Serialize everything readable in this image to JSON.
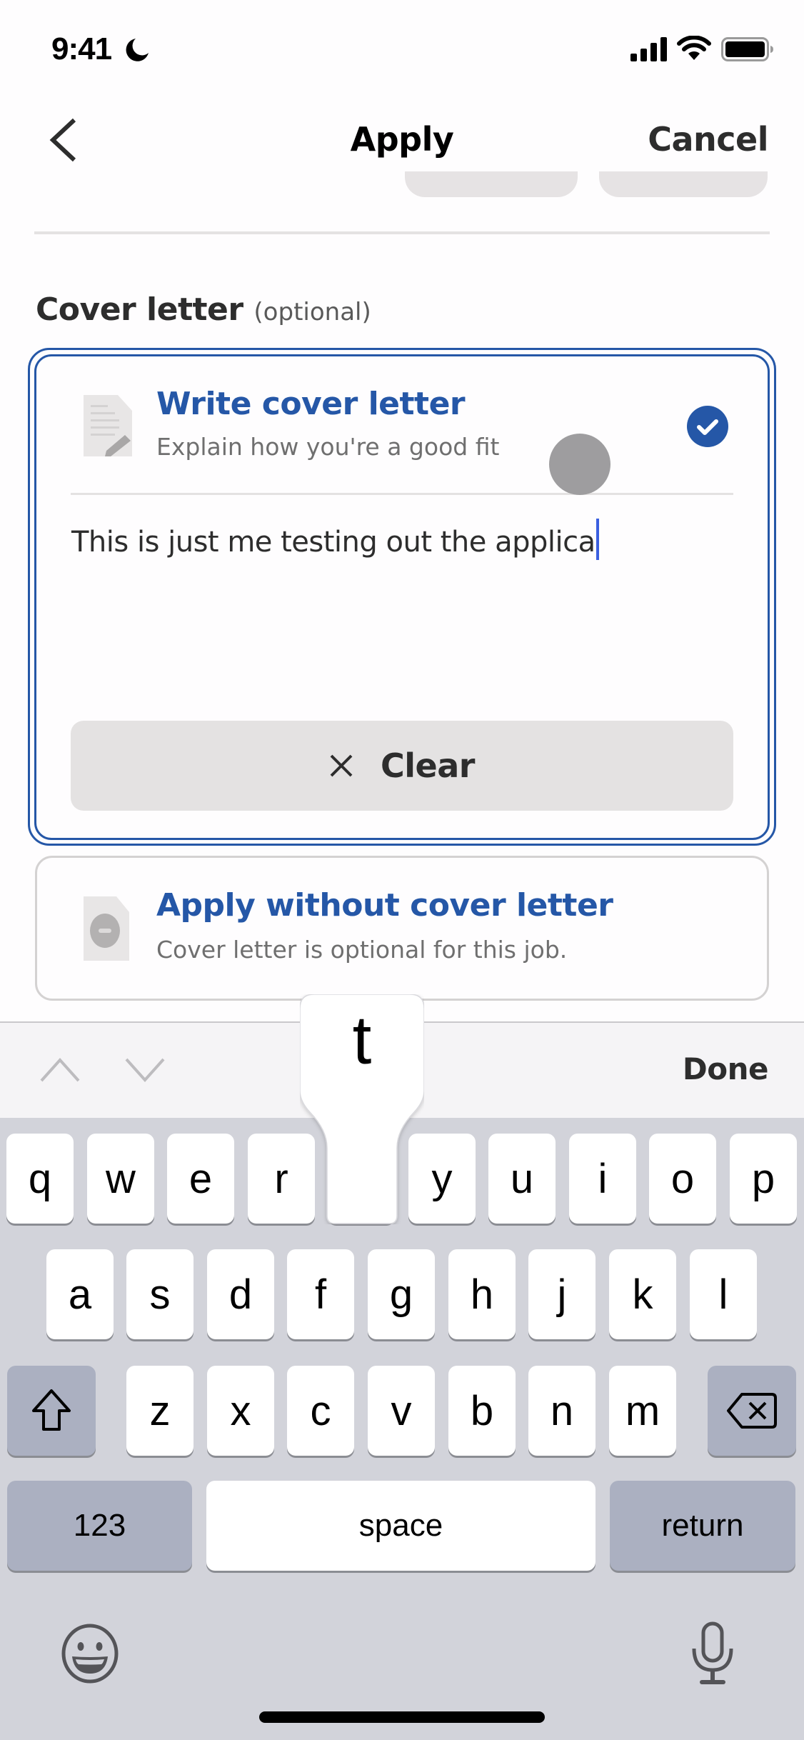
{
  "status_bar": {
    "time": "9:41",
    "focus_icon": "moon-icon",
    "icons": [
      "cellular-signal-icon",
      "wifi-icon",
      "battery-icon"
    ]
  },
  "nav": {
    "back_icon": "chevron-left-icon",
    "title": "Apply",
    "cancel_label": "Cancel"
  },
  "cover_letter": {
    "heading": "Cover letter",
    "heading_suffix": "(optional)",
    "options": [
      {
        "icon": "document-pencil-icon",
        "title": "Write cover letter",
        "subtitle": "Explain how you're a good fit",
        "selected": true,
        "text_value": "This is just me testing out the applica"
      },
      {
        "icon": "document-minus-icon",
        "title": "Apply without cover letter",
        "subtitle": "Cover letter is optional for this job.",
        "selected": false
      }
    ],
    "clear_label": "Clear",
    "clear_icon": "close-icon"
  },
  "keyboard_toolbar": {
    "prev_icon": "chevron-up-icon",
    "next_icon": "chevron-down-icon",
    "done_label": "Done"
  },
  "keyboard": {
    "row1": [
      "q",
      "w",
      "e",
      "r",
      "t",
      "y",
      "u",
      "i",
      "o",
      "p"
    ],
    "row2": [
      "a",
      "s",
      "d",
      "f",
      "g",
      "h",
      "j",
      "k",
      "l"
    ],
    "row3": [
      "z",
      "x",
      "c",
      "v",
      "b",
      "n",
      "m"
    ],
    "shift_icon": "shift-icon",
    "backspace_icon": "backspace-icon",
    "numbers_label": "123",
    "space_label": "space",
    "return_label": "return",
    "pressed_key": "t",
    "emoji_icon": "emoji-icon",
    "dictation_icon": "microphone-icon"
  },
  "colors": {
    "accent": "#2557a7",
    "caret": "#3a5fe0",
    "keyboard_bg": "#d2d3da",
    "special_key": "#abb0c1"
  }
}
